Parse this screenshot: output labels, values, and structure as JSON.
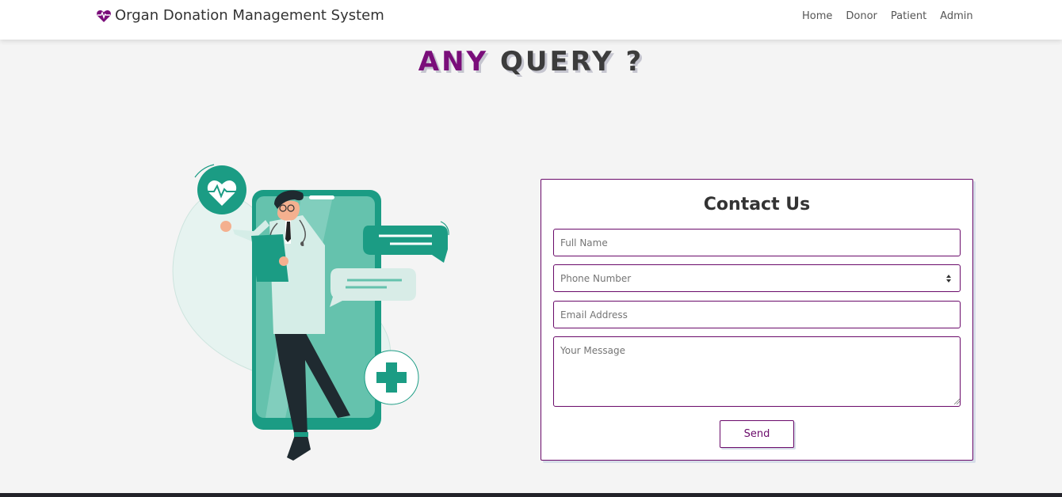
{
  "nav": {
    "brand": "Organ Donation Management System",
    "links": [
      "Home",
      "Donor",
      "Patient",
      "Admin"
    ]
  },
  "heading": {
    "word1": "ANY",
    "word2": "QUERY ?"
  },
  "contact": {
    "title": "Contact Us",
    "name_placeholder": "Full Name",
    "phone_placeholder": "Phone Number",
    "email_placeholder": "Email Address",
    "message_placeholder": "Your Message",
    "send_label": "Send"
  },
  "icons": {
    "brand": "heartbeat-icon",
    "illustration": "doctor-phone-illustration"
  },
  "colors": {
    "accent": "#6a0a6a",
    "teal": "#1b9c84",
    "heading_dark": "#3c3c3c"
  }
}
